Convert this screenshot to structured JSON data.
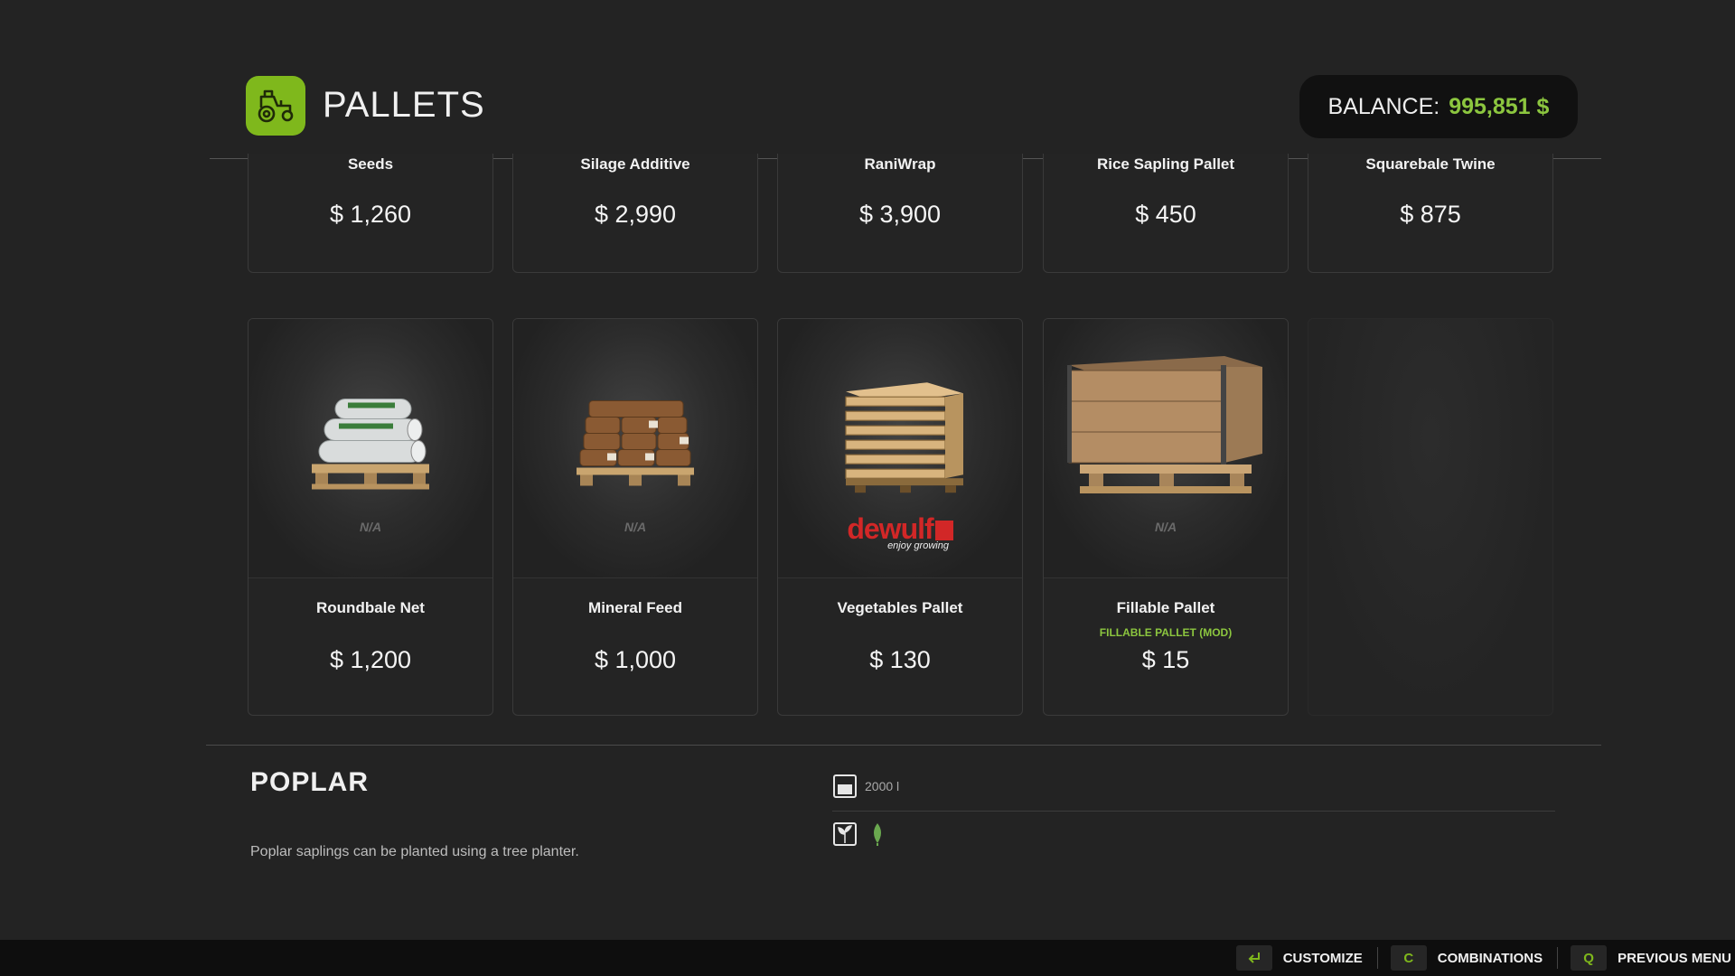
{
  "header": {
    "title": "PALLETS",
    "category_icon": "tractor-icon",
    "balance_label": "BALANCE:",
    "balance_value": "995,851 $"
  },
  "row1": [
    {
      "name": "Seeds",
      "price": "$ 1,260"
    },
    {
      "name": "Silage Additive",
      "price": "$ 2,990"
    },
    {
      "name": "RaniWrap",
      "price": "$ 3,900"
    },
    {
      "name": "Rice Sapling Pallet",
      "price": "$ 450"
    },
    {
      "name": "Squarebale Twine",
      "price": "$ 875"
    }
  ],
  "row2": [
    {
      "name": "Roundbale Net",
      "price": "$ 1,200",
      "brand": "N/A",
      "image": "net-rolls-pallet"
    },
    {
      "name": "Mineral Feed",
      "price": "$ 1,000",
      "brand": "N/A",
      "image": "feed-bags-pallet"
    },
    {
      "name": "Vegetables Pallet",
      "price": "$ 130",
      "brand_wordmark": "dewulf",
      "brand_tagline": "enjoy growing",
      "image": "wooden-crate"
    },
    {
      "name": "Fillable Pallet",
      "mod_label": "FILLABLE PALLET (MOD)",
      "price": "$ 15",
      "brand": "N/A",
      "image": "wooden-pallet-box"
    }
  ],
  "detail": {
    "title": "POPLAR",
    "description": "Poplar saplings can be planted using a tree planter.",
    "capacity": "2000 l",
    "capacity_icon": "capacity-icon",
    "filltype_icon": "tree-sapling-icon",
    "fill_icon": "poplar-leaf-icon"
  },
  "footer": {
    "customize": {
      "key_icon": "enter-key-icon",
      "label": "CUSTOMIZE"
    },
    "combinations": {
      "key": "C",
      "label": "COMBINATIONS"
    },
    "previous": {
      "key": "Q",
      "label": "PREVIOUS MENU"
    }
  },
  "colors": {
    "accent": "#7fb81c",
    "balance_green": "#8cc63f",
    "background": "#232323",
    "brand_red": "#d22727"
  }
}
